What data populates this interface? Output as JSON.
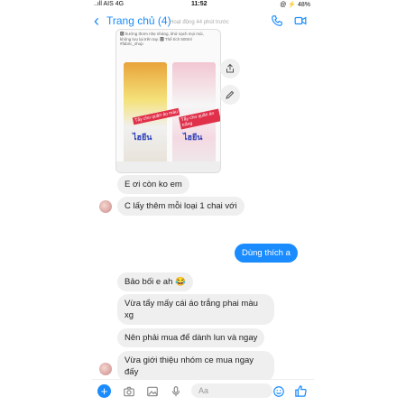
{
  "status_bar": {
    "carrier": "..ıll AIS 4G",
    "time": "11:52",
    "battery": "@ ⚡ 48%"
  },
  "nav": {
    "back_icon": "chevron-left-icon",
    "title": "Trang chủ (4)",
    "subtitle": "Hoạt động 44 phút trước",
    "call_icon": "phone-icon",
    "video_icon": "video-icon"
  },
  "shared_post": {
    "caption": "🅾 hướng thơm nhẹ nhàng, khử sạch mọi mùi, không lưu lại trên tay. 🅾 Thể tích 500ml #fabric_shop",
    "label_left": "Tẩy cho quần áo màu",
    "label_right": "Tẩy cho quần áo trắng",
    "brand_left": "ไฮยีน",
    "brand_right": "ไฮยีน",
    "share_icon": "share-icon",
    "edit_icon": "edit-icon"
  },
  "messages": [
    {
      "from": "them",
      "text": "E ơi còn ko em"
    },
    {
      "from": "them",
      "text": "C lấy thêm mỗi loại 1 chai với"
    },
    {
      "from": "me",
      "text": "Dùng thích a"
    },
    {
      "from": "them",
      "text": "Bảo bối e ah 😂"
    },
    {
      "from": "them",
      "text": "Vừa tẩy mấy cái áo trắng phai màu xg"
    },
    {
      "from": "them",
      "text": "Nên phải mua để dành lun và ngay"
    },
    {
      "from": "them",
      "text": "Vừa giới thiệu nhóm ce mua ngay đấy"
    }
  ],
  "composer": {
    "plus": "+",
    "placeholder": "Aa",
    "icons": [
      "camera-icon",
      "image-icon",
      "microphone-icon",
      "emoji-icon",
      "like-icon"
    ]
  }
}
